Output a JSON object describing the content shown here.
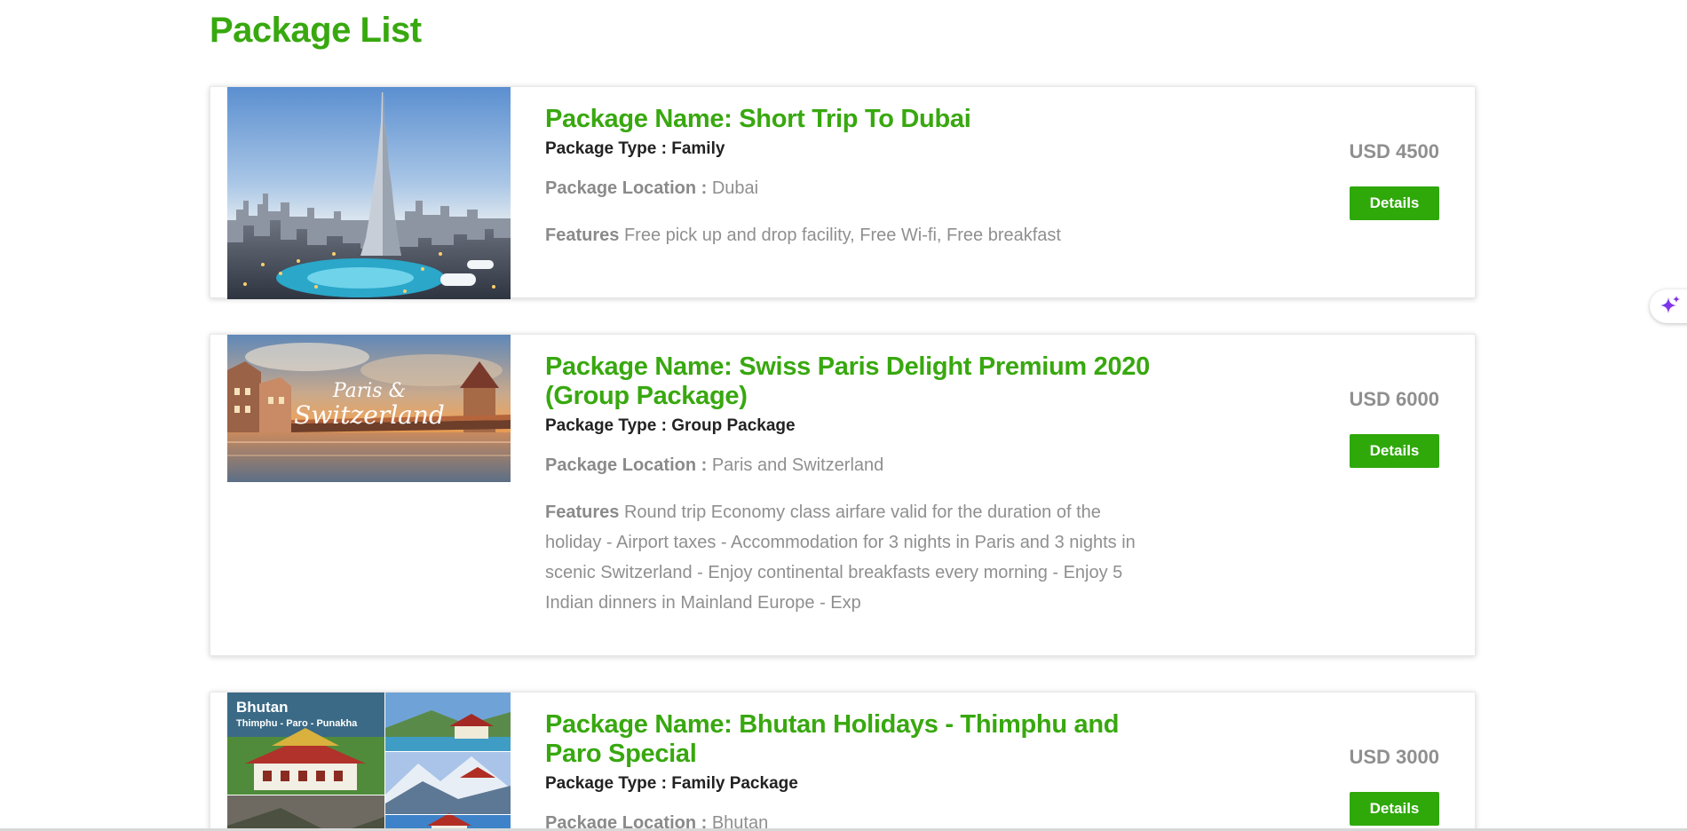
{
  "page": {
    "title": "Package List"
  },
  "packages": [
    {
      "name": "Package Name: Short Trip To Dubai",
      "type_label": "Package Type : ",
      "type": "Family",
      "location_label": "Package Location : ",
      "location": "Dubai",
      "features_label": "Features ",
      "features": "Free pick up and drop facility, Free Wi-fi, Free breakfast",
      "price": "USD 4500",
      "button": "Details",
      "image": "dubai-skyline-image"
    },
    {
      "name": "Package Name: Swiss Paris Delight Premium 2020 (Group Package)",
      "type_label": "Package Type : ",
      "type": "Group Package",
      "location_label": "Package Location : ",
      "location": "Paris and Switzerland",
      "features_label": "Features ",
      "features": "Round trip Economy class airfare valid for the duration of the holiday - Airport taxes - Accommodation for 3 nights in Paris and 3 nights in scenic Switzerland - Enjoy continental breakfasts every morning - Enjoy 5 Indian dinners in Mainland Europe - Exp",
      "price": "USD 6000",
      "button": "Details",
      "image": "paris-switzerland-image",
      "image_text_line1": "Paris &",
      "image_text_line2": "Switzerland"
    },
    {
      "name": "Package Name: Bhutan Holidays - Thimphu and Paro Special",
      "type_label": "Package Type : ",
      "type": "Family Package",
      "location_label": "Package Location : ",
      "location": "Bhutan",
      "price": "USD 3000",
      "button": "Details",
      "image": "bhutan-collage-image",
      "image_text_title": "Bhutan",
      "image_text_sub": "Thimphu - Paro - Punakha"
    }
  ],
  "colors": {
    "accent": "#38a80f",
    "button": "#2fa80a",
    "muted": "#8f8f8f",
    "dark": "#222222"
  },
  "icons": {
    "assistant": "sparkle-icon"
  }
}
